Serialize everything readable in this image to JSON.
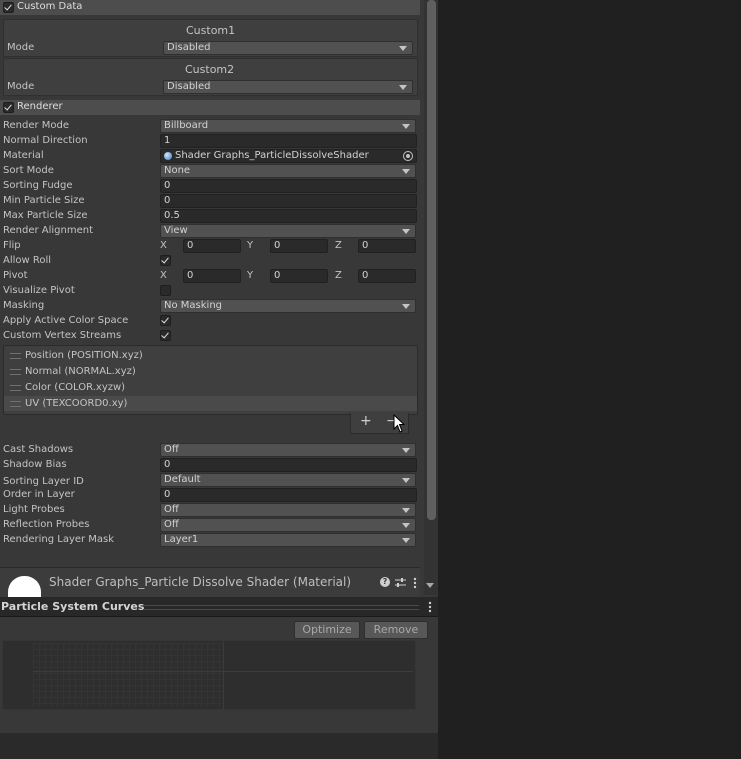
{
  "custom_data": {
    "label": "Custom Data",
    "custom1": {
      "title": "Custom1",
      "mode_label": "Mode",
      "mode_value": "Disabled"
    },
    "custom2": {
      "title": "Custom2",
      "mode_label": "Mode",
      "mode_value": "Disabled"
    }
  },
  "renderer": {
    "label": "Renderer",
    "render_mode": {
      "label": "Render Mode",
      "value": "Billboard"
    },
    "normal_direction": {
      "label": "Normal Direction",
      "value": "1"
    },
    "material": {
      "label": "Material",
      "value": "Shader Graphs_ParticleDissolveShader"
    },
    "sort_mode": {
      "label": "Sort Mode",
      "value": "None"
    },
    "sorting_fudge": {
      "label": "Sorting Fudge",
      "value": "0"
    },
    "min_particle_size": {
      "label": "Min Particle Size",
      "value": "0"
    },
    "max_particle_size": {
      "label": "Max Particle Size",
      "value": "0.5"
    },
    "render_alignment": {
      "label": "Render Alignment",
      "value": "View"
    },
    "flip": {
      "label": "Flip",
      "x_label": "X",
      "x": "0",
      "y_label": "Y",
      "y": "0",
      "z_label": "Z",
      "z": "0"
    },
    "allow_roll": {
      "label": "Allow Roll"
    },
    "pivot": {
      "label": "Pivot",
      "x_label": "X",
      "x": "0",
      "y_label": "Y",
      "y": "0",
      "z_label": "Z",
      "z": "0"
    },
    "visualize_pivot": {
      "label": "Visualize Pivot"
    },
    "masking": {
      "label": "Masking",
      "value": "No Masking"
    },
    "apply_active_color_space": {
      "label": "Apply Active Color Space"
    },
    "custom_vertex_streams": {
      "label": "Custom Vertex Streams"
    },
    "streams": [
      "Position (POSITION.xyz)",
      "Normal (NORMAL.xyz)",
      "Color (COLOR.xyzw)",
      "UV (TEXCOORD0.xy)"
    ],
    "add_button": "+",
    "remove_button": "−",
    "cast_shadows": {
      "label": "Cast Shadows",
      "value": "Off"
    },
    "shadow_bias": {
      "label": "Shadow Bias",
      "value": "0"
    },
    "sorting_layer_id": {
      "label": "Sorting Layer ID",
      "value": "Default"
    },
    "order_in_layer": {
      "label": "Order in Layer",
      "value": "0"
    },
    "light_probes": {
      "label": "Light Probes",
      "value": "Off"
    },
    "reflection_probes": {
      "label": "Reflection Probes",
      "value": "Off"
    },
    "rendering_layer_mask": {
      "label": "Rendering Layer Mask",
      "value": "Layer1"
    }
  },
  "material_bar": {
    "name": "Shader Graphs_Particle Dissolve Shader (Material)"
  },
  "curves": {
    "title": "Particle System Curves",
    "optimize_button": "Optimize",
    "remove_button": "Remove"
  }
}
